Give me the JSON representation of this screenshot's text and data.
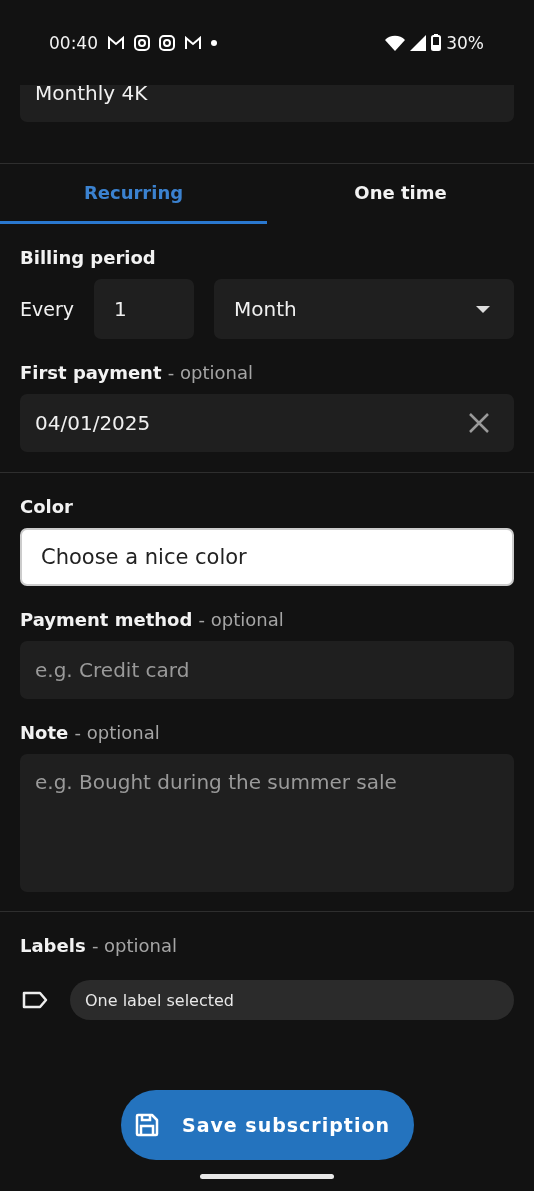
{
  "status_bar": {
    "time": "00:40",
    "battery": "30%"
  },
  "name_field": {
    "value": "Monthly 4K"
  },
  "tabs": [
    {
      "label": "Recurring",
      "selected": true
    },
    {
      "label": "One time",
      "selected": false
    }
  ],
  "billing_period": {
    "label": "Billing period",
    "every": "Every",
    "count": "1",
    "unit": "Month"
  },
  "first_payment": {
    "label": "First payment",
    "hint": "- optional",
    "value": "04/01/2025"
  },
  "color": {
    "label": "Color",
    "placeholder": "Choose a nice color"
  },
  "payment_method": {
    "label": "Payment method",
    "hint": "- optional",
    "placeholder": "e.g. Credit card"
  },
  "note": {
    "label": "Note",
    "hint": "- optional",
    "placeholder": "e.g. Bought during the summer sale"
  },
  "labels": {
    "label": "Labels",
    "hint": "- optional",
    "value": "One label selected"
  },
  "save_button": {
    "label": "Save subscription"
  }
}
